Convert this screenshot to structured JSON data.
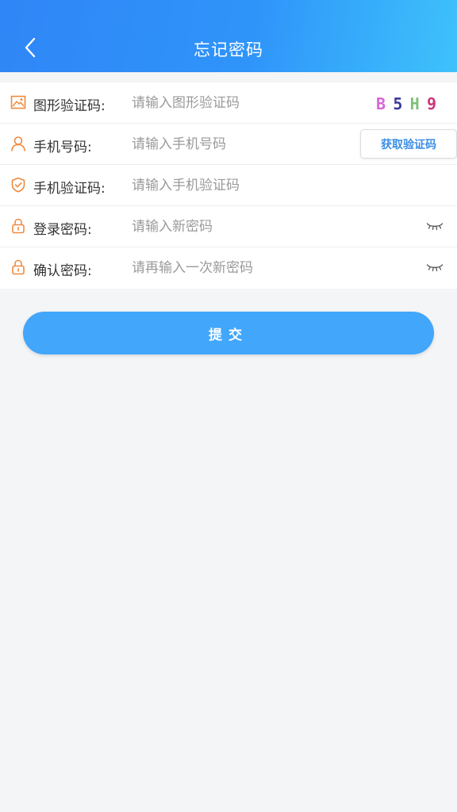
{
  "header": {
    "title": "忘记密码",
    "back_icon": "chevron-left-icon"
  },
  "form": {
    "rows": [
      {
        "icon": "image-icon",
        "label": "图形验证码:",
        "placeholder": "请输入图形验证码",
        "value": ""
      },
      {
        "icon": "user-icon",
        "label": "手机号码:",
        "placeholder": "请输入手机号码",
        "value": ""
      },
      {
        "icon": "shield-icon",
        "label": "手机验证码:",
        "placeholder": "请输入手机验证码",
        "value": ""
      },
      {
        "icon": "lock-icon",
        "label": "登录密码:",
        "placeholder": "请输入新密码",
        "value": ""
      },
      {
        "icon": "lock-icon",
        "label": "确认密码:",
        "placeholder": "请再输入一次新密码",
        "value": ""
      }
    ],
    "captcha": {
      "chars": [
        "B",
        "5",
        "H",
        "9"
      ],
      "colors": [
        "#d667d9",
        "#3a3a9a",
        "#7fc07a",
        "#c9387a"
      ]
    },
    "get_code_label": "获取验证码",
    "eye_icon": "eye-closed-icon"
  },
  "submit": {
    "label": "提交"
  },
  "colors": {
    "header_start": "#2f86f6",
    "header_end": "#3ec2fb",
    "icon_orange": "#f08a3e",
    "accent_blue": "#3a8ee6",
    "submit_bg": "#42a6fb"
  }
}
